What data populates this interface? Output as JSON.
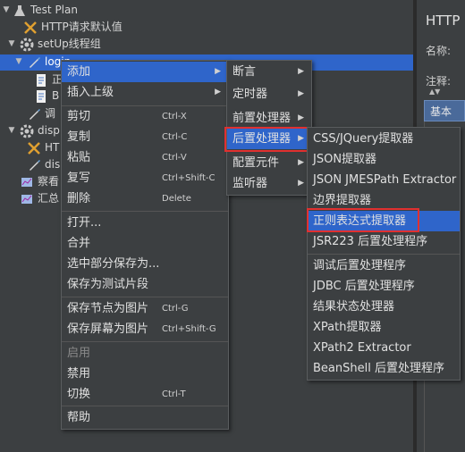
{
  "tree": {
    "test_plan": "Test Plan",
    "http_defaults": "HTTP请求默认值",
    "setup_group": "setUp线程组",
    "login": "login",
    "child1": "正",
    "child2": "B",
    "debug": "调",
    "disp": "disp",
    "ht": "HT",
    "dis": "dis",
    "view": "察看",
    "summary": "汇总"
  },
  "right_panel": {
    "title": "HTTP",
    "name_label": "名称:",
    "comment_label": "注释:",
    "basic_tab": "基本"
  },
  "context_menu": {
    "add": "添加",
    "insert_parent": "插入上级",
    "cut": "剪切",
    "cut_sc": "Ctrl-X",
    "copy": "复制",
    "copy_sc": "Ctrl-C",
    "paste": "粘贴",
    "paste_sc": "Ctrl-V",
    "duplicate": "复写",
    "duplicate_sc": "Ctrl+Shift-C",
    "delete": "删除",
    "delete_sc": "Delete",
    "open": "打开...",
    "merge": "合并",
    "save_selection": "选中部分保存为...",
    "save_fragment": "保存为测试片段",
    "save_node_image": "保存节点为图片",
    "save_node_image_sc": "Ctrl-G",
    "save_screen_image": "保存屏幕为图片",
    "save_screen_image_sc": "Ctrl+Shift-G",
    "enable": "启用",
    "disable": "禁用",
    "toggle": "切换",
    "toggle_sc": "Ctrl-T",
    "help": "帮助"
  },
  "add_submenu": {
    "assertion": "断言",
    "timer": "定时器",
    "pre_processor": "前置处理器",
    "post_processor": "后置处理器",
    "config_element": "配置元件",
    "listener": "监听器"
  },
  "post_submenu": {
    "items": [
      "CSS/JQuery提取器",
      "JSON提取器",
      "JSON JMESPath Extractor",
      "边界提取器",
      "正则表达式提取器",
      "JSR223 后置处理程序",
      "调试后置处理程序",
      "JDBC 后置处理程序",
      "结果状态处理器",
      "XPath提取器",
      "XPath2 Extractor",
      "BeanShell 后置处理程序"
    ]
  },
  "colors": {
    "highlight": "#2f65ca",
    "red_box": "#e03030"
  }
}
